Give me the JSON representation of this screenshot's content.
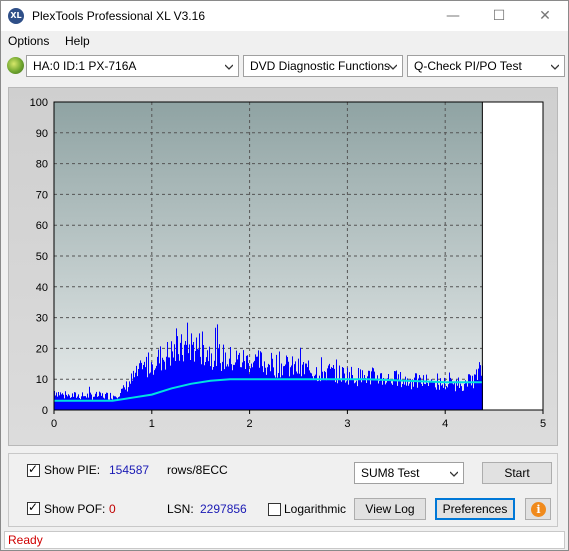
{
  "window": {
    "title": "PlexTools Professional XL V3.16",
    "icon_text": "XL",
    "minimize_glyph": "—",
    "maximize_glyph": "☐",
    "close_glyph": "✕"
  },
  "menu": {
    "options_label": "Options",
    "help_label": "Help"
  },
  "toolbar": {
    "drive": "HA:0 ID:1  PX-716A",
    "function": "DVD Diagnostic Functions",
    "test": "Q-Check PI/PO Test"
  },
  "chart_data": {
    "type": "bar",
    "x_ticks": [
      "0",
      "1",
      "2",
      "3",
      "4",
      "5"
    ],
    "y_ticks": [
      "0",
      "10",
      "20",
      "30",
      "40",
      "50",
      "60",
      "70",
      "80",
      "90",
      "100"
    ],
    "xlim": [
      0,
      5
    ],
    "ylim": [
      0,
      100
    ],
    "grid": true,
    "scan_end_x": 4.38,
    "series": [
      {
        "kind": "PIE bars",
        "color": "#0000ff",
        "x": [
          0.0,
          0.1,
          0.2,
          0.3,
          0.4,
          0.5,
          0.6,
          0.7,
          0.8,
          0.9,
          1.0,
          1.1,
          1.2,
          1.3,
          1.4,
          1.5,
          1.6,
          1.7,
          1.8,
          1.9,
          2.0,
          2.1,
          2.2,
          2.3,
          2.4,
          2.5,
          2.6,
          2.7,
          2.8,
          2.9,
          3.0,
          3.1,
          3.2,
          3.3,
          3.4,
          3.5,
          3.6,
          3.7,
          3.8,
          3.9,
          4.0,
          4.1,
          4.2,
          4.3,
          4.38
        ],
        "y": [
          8,
          6,
          6,
          6,
          6,
          6,
          6,
          8,
          13,
          17,
          20,
          22,
          24,
          25,
          27,
          26,
          24,
          22,
          21,
          21,
          20,
          20,
          19,
          19,
          18,
          17,
          17,
          16,
          16,
          15,
          15,
          14,
          14,
          14,
          13,
          13,
          12,
          12,
          12,
          11,
          11,
          11,
          11,
          13,
          18
        ]
      },
      {
        "kind": "PIE 8ECC sum line",
        "color": "#00e0e0",
        "x": [
          0.0,
          0.2,
          0.4,
          0.6,
          0.8,
          1.0,
          1.2,
          1.4,
          1.6,
          1.8,
          2.0,
          2.4,
          2.8,
          3.2,
          3.6,
          4.0,
          4.38
        ],
        "y": [
          3,
          3,
          3,
          3,
          4,
          5,
          7,
          8.5,
          9.5,
          10,
          10,
          10,
          10,
          10,
          9.5,
          9,
          9
        ]
      }
    ]
  },
  "controls": {
    "show_pie_label": "Show PIE:",
    "show_pie_value": "154587",
    "show_pie_unit": "rows/8ECC",
    "show_pof_label": "Show POF:",
    "show_pof_value": "0",
    "lsn_label": "LSN:",
    "lsn_value": "2297856",
    "logarithmic_label": "Logarithmic",
    "sum_select": "SUM8 Test",
    "start_button": "Start",
    "view_log_button": "View Log",
    "preferences_button": "Preferences",
    "info_glyph": "i",
    "check_glyph": "✓"
  },
  "status": {
    "text": "Ready"
  }
}
